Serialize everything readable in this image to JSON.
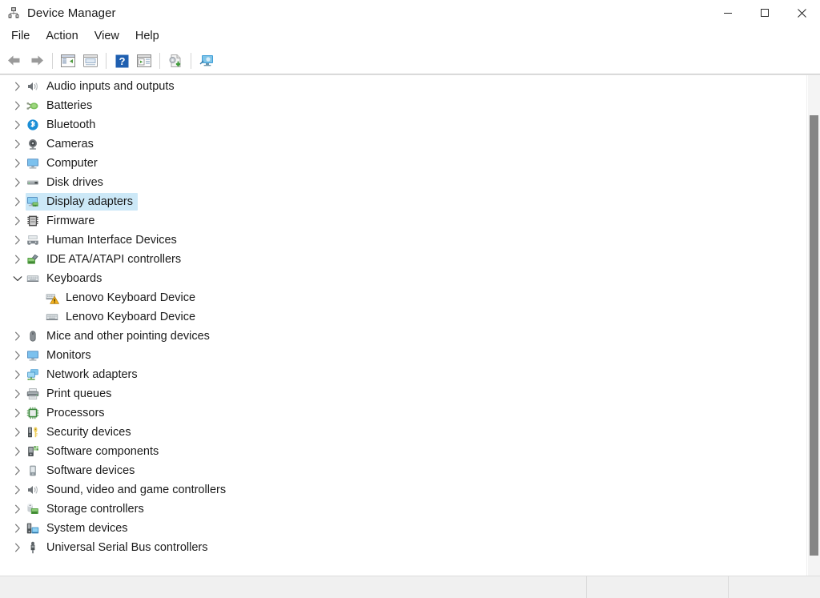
{
  "window": {
    "title": "Device Manager",
    "icon": "device-manager-icon",
    "controls": [
      {
        "name": "minimize-button",
        "glyph": "minimize"
      },
      {
        "name": "maximize-button",
        "glyph": "maximize"
      },
      {
        "name": "close-button",
        "glyph": "close"
      }
    ]
  },
  "menubar": {
    "items": [
      {
        "label": "File"
      },
      {
        "label": "Action"
      },
      {
        "label": "View"
      },
      {
        "label": "Help"
      }
    ]
  },
  "toolbar": {
    "buttons": [
      {
        "name": "back-button",
        "icon": "back-arrow-icon"
      },
      {
        "name": "forward-button",
        "icon": "forward-arrow-icon"
      },
      {
        "name": "separator-1",
        "icon": "separator"
      },
      {
        "name": "show-hide-console-tree-button",
        "icon": "console-tree-icon"
      },
      {
        "name": "properties-button",
        "icon": "properties-icon"
      },
      {
        "name": "separator-2",
        "icon": "separator"
      },
      {
        "name": "help-button",
        "icon": "help-question-icon"
      },
      {
        "name": "update-driver-button",
        "icon": "update-driver-icon"
      },
      {
        "name": "separator-3",
        "icon": "separator"
      },
      {
        "name": "scan-for-hardware-changes-button",
        "icon": "scan-hardware-icon"
      },
      {
        "name": "separator-4",
        "icon": "separator"
      },
      {
        "name": "display-device-button",
        "icon": "display-device-icon"
      }
    ]
  },
  "tree": {
    "items": [
      {
        "label": "Audio inputs and outputs",
        "icon": "speaker-icon",
        "state": "collapsed",
        "level": 0,
        "selected": false
      },
      {
        "label": "Batteries",
        "icon": "battery-icon",
        "state": "collapsed",
        "level": 0,
        "selected": false
      },
      {
        "label": "Bluetooth",
        "icon": "bluetooth-icon",
        "state": "collapsed",
        "level": 0,
        "selected": false
      },
      {
        "label": "Cameras",
        "icon": "camera-icon",
        "state": "collapsed",
        "level": 0,
        "selected": false
      },
      {
        "label": "Computer",
        "icon": "computer-monitor-icon",
        "state": "collapsed",
        "level": 0,
        "selected": false
      },
      {
        "label": "Disk drives",
        "icon": "disk-drive-icon",
        "state": "collapsed",
        "level": 0,
        "selected": false
      },
      {
        "label": "Display adapters",
        "icon": "display-adapter-icon",
        "state": "collapsed",
        "level": 0,
        "selected": true
      },
      {
        "label": "Firmware",
        "icon": "firmware-chip-icon",
        "state": "collapsed",
        "level": 0,
        "selected": false
      },
      {
        "label": "Human Interface Devices",
        "icon": "hid-icon",
        "state": "collapsed",
        "level": 0,
        "selected": false
      },
      {
        "label": "IDE ATA/ATAPI controllers",
        "icon": "ide-controller-icon",
        "state": "collapsed",
        "level": 0,
        "selected": false
      },
      {
        "label": "Keyboards",
        "icon": "keyboard-icon",
        "state": "expanded",
        "level": 0,
        "selected": false
      },
      {
        "label": "Lenovo Keyboard Device",
        "icon": "keyboard-warning-icon",
        "state": "leaf",
        "level": 1,
        "selected": false
      },
      {
        "label": "Lenovo Keyboard Device",
        "icon": "keyboard-icon",
        "state": "leaf",
        "level": 1,
        "selected": false
      },
      {
        "label": "Mice and other pointing devices",
        "icon": "mouse-icon",
        "state": "collapsed",
        "level": 0,
        "selected": false
      },
      {
        "label": "Monitors",
        "icon": "computer-monitor-icon",
        "state": "collapsed",
        "level": 0,
        "selected": false
      },
      {
        "label": "Network adapters",
        "icon": "network-adapter-icon",
        "state": "collapsed",
        "level": 0,
        "selected": false
      },
      {
        "label": "Print queues",
        "icon": "printer-icon",
        "state": "collapsed",
        "level": 0,
        "selected": false
      },
      {
        "label": "Processors",
        "icon": "processor-icon",
        "state": "collapsed",
        "level": 0,
        "selected": false
      },
      {
        "label": "Security devices",
        "icon": "security-device-icon",
        "state": "collapsed",
        "level": 0,
        "selected": false
      },
      {
        "label": "Software components",
        "icon": "software-component-icon",
        "state": "collapsed",
        "level": 0,
        "selected": false
      },
      {
        "label": "Software devices",
        "icon": "software-device-icon",
        "state": "collapsed",
        "level": 0,
        "selected": false
      },
      {
        "label": "Sound, video and game controllers",
        "icon": "speaker-icon",
        "state": "collapsed",
        "level": 0,
        "selected": false
      },
      {
        "label": "Storage controllers",
        "icon": "storage-controller-icon",
        "state": "collapsed",
        "level": 0,
        "selected": false
      },
      {
        "label": "System devices",
        "icon": "system-device-icon",
        "state": "collapsed",
        "level": 0,
        "selected": false
      },
      {
        "label": "Universal Serial Bus controllers",
        "icon": "usb-icon",
        "state": "collapsed",
        "level": 0,
        "selected": false
      }
    ]
  },
  "scrollbar": {
    "thumb_top_pct": 8,
    "thumb_height_pct": 88
  },
  "statusbar": {
    "panes": [
      "",
      "",
      ""
    ]
  },
  "colors": {
    "selection": "#cce8f7",
    "text": "#1b1b1b",
    "statusbar_bg": "#f0f0f0",
    "scrollbar_thumb": "#868686"
  }
}
